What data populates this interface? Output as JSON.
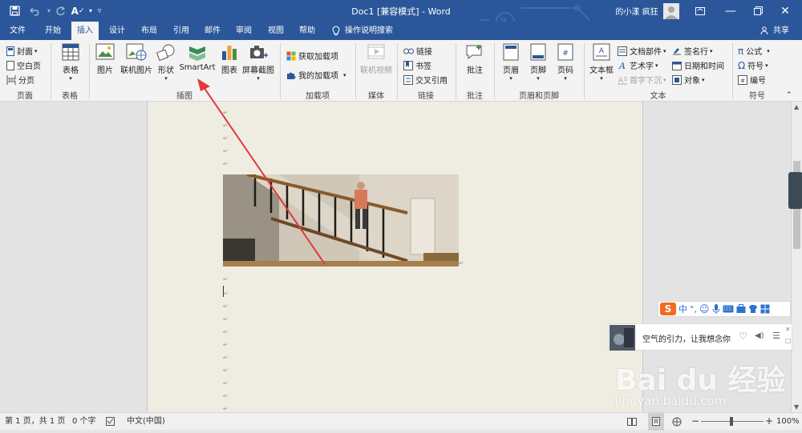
{
  "window": {
    "title": "Doc1 [兼容模式] - Word",
    "user": "的小漾 疯狂"
  },
  "tabs": [
    "文件",
    "开始",
    "插入",
    "设计",
    "布局",
    "引用",
    "邮件",
    "审阅",
    "视图",
    "帮助",
    "操作说明搜索"
  ],
  "share_label": "共享",
  "ribbon": {
    "pages": {
      "cover": "封面",
      "blank": "空白页",
      "break": "分页",
      "group": "页面"
    },
    "tables": {
      "table": "表格",
      "group": "表格"
    },
    "illustrations": {
      "picture": "图片",
      "online_picture": "联机图片",
      "shapes": "形状",
      "smartart": "SmartArt",
      "chart": "图表",
      "screenshot": "屏幕截图",
      "group": "插图"
    },
    "addins": {
      "get": "获取加载项",
      "my": "我的加载项",
      "group": "加载项"
    },
    "media": {
      "online_video": "联机视频",
      "group": "媒体"
    },
    "links": {
      "link": "链接",
      "bookmark": "书签",
      "crossref": "交叉引用",
      "group": "链接"
    },
    "comments": {
      "comment": "批注",
      "group": "批注"
    },
    "header_footer": {
      "header": "页眉",
      "footer": "页脚",
      "page_number": "页码",
      "group": "页眉和页脚"
    },
    "text": {
      "textbox": "文本框",
      "docparts": "文档部件",
      "wordart": "艺术字",
      "dropcap": "首字下沉",
      "signature": "签名行",
      "datetime": "日期和时间",
      "object": "对象",
      "group": "文本"
    },
    "symbols": {
      "equation": "公式",
      "symbol": "符号",
      "numbering": "编号",
      "group": "符号"
    }
  },
  "ime": {
    "cn": "中"
  },
  "music": {
    "text": "空气的引力，让我想念你"
  },
  "watermark": {
    "brand": "Bai du 经验",
    "url": "jingyan.baidu.com"
  },
  "status": {
    "page": "第 1 页，共 1 页",
    "words": "0 个字",
    "lang": "中文(中国)",
    "zoom": "100%"
  },
  "colors": {
    "accent": "#2b579a",
    "annotation_arrow": "#e03a3a",
    "page_bg": "#efede2"
  }
}
